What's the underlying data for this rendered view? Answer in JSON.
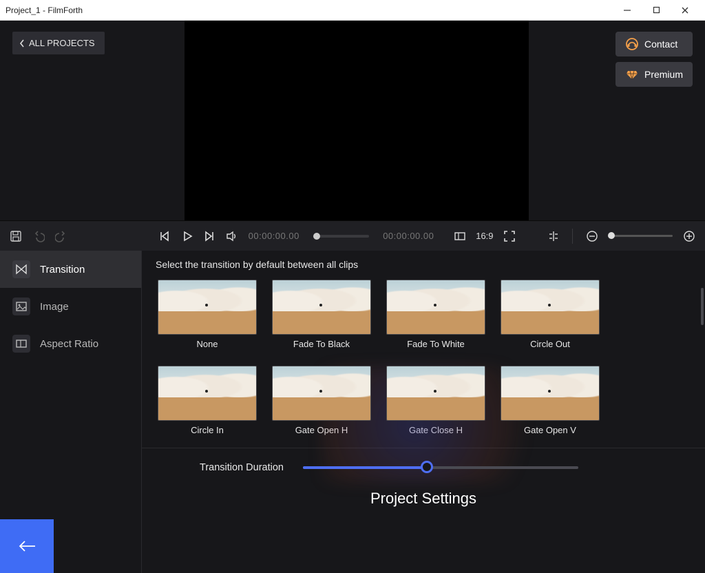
{
  "window": {
    "title": "Project_1 - FilmForth"
  },
  "header": {
    "all_projects": "ALL PROJECTS",
    "contact": "Contact",
    "premium": "Premium"
  },
  "controls": {
    "time_current": "00:00:00.00",
    "time_total": "00:00:00.00",
    "aspect": "16:9"
  },
  "sidebar": {
    "items": [
      {
        "label": "Transition"
      },
      {
        "label": "Image"
      },
      {
        "label": "Aspect Ratio"
      }
    ]
  },
  "panel": {
    "hint": "Select the transition by default between all clips",
    "transitions": [
      {
        "label": "None"
      },
      {
        "label": "Fade To Black"
      },
      {
        "label": "Fade To White"
      },
      {
        "label": "Circle Out"
      },
      {
        "label": "Circle In"
      },
      {
        "label": "Gate Open H"
      },
      {
        "label": "Gate Close H"
      },
      {
        "label": "Gate Open V"
      }
    ],
    "duration_label": "Transition Duration"
  },
  "footer": {
    "title": "Project Settings"
  }
}
